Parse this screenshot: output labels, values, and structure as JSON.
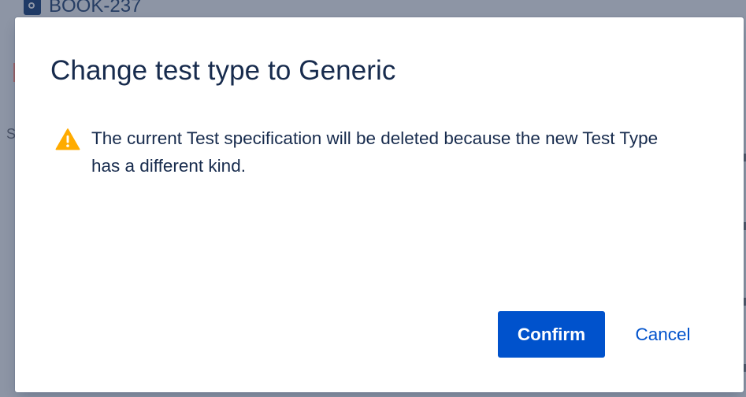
{
  "background": {
    "issue_key": "BOOK-237",
    "partial_letter": "S"
  },
  "dialog": {
    "title": "Change test type to Generic",
    "warning_icon": "warning-icon",
    "warning_message": "The current Test specification will be deleted because the new Test Type has a different kind.",
    "confirm_label": "Confirm",
    "cancel_label": "Cancel"
  },
  "colors": {
    "primary": "#0052cc",
    "warning": "#ffab00",
    "text": "#172b4d",
    "overlay": "#8d95a5"
  }
}
